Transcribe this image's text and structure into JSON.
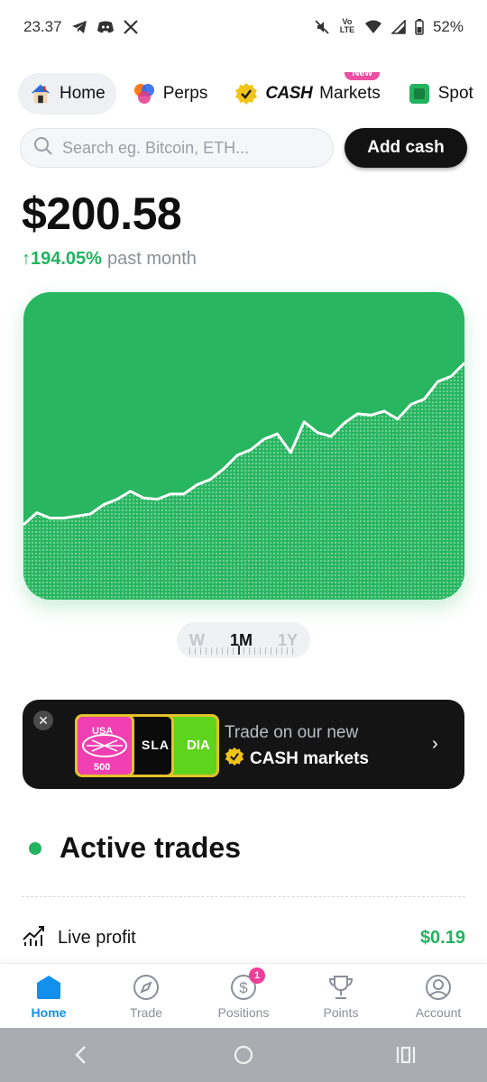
{
  "status_bar": {
    "time": "23.37",
    "battery": "52%",
    "icons": [
      "telegram-icon",
      "discord-icon",
      "x-icon",
      "mute-icon",
      "volte-icon",
      "wifi-icon",
      "signal-icon",
      "battery-icon"
    ],
    "volte_label": "Vo LTE"
  },
  "nav_tabs": {
    "items": [
      {
        "label": "Home",
        "icon": "home-house-icon",
        "active": true
      },
      {
        "label": "Perps",
        "icon": "perps-logo-icon"
      },
      {
        "label": "Markets",
        "prefix": "CASH",
        "icon": "verified-badge-icon",
        "badge": "New"
      },
      {
        "label": "Spot",
        "icon": "spot-square-icon"
      }
    ]
  },
  "search": {
    "placeholder": "Search eg. Bitcoin, ETH..."
  },
  "add_cash_label": "Add cash",
  "balance": "$200.58",
  "change": {
    "arrow": "↑",
    "percent": "194.05%",
    "label": "past month"
  },
  "chart_data": {
    "type": "area",
    "title": "",
    "xlabel": "",
    "ylabel": "",
    "y": [
      0.56,
      0.65,
      0.61,
      0.61,
      0.625,
      0.64,
      0.71,
      0.75,
      0.81,
      0.76,
      0.75,
      0.79,
      0.79,
      0.86,
      0.9,
      0.98,
      1.08,
      1.12,
      1.2,
      1.24,
      1.1,
      1.33,
      1.25,
      1.22,
      1.32,
      1.39,
      1.38,
      1.41,
      1.35,
      1.46,
      1.5,
      1.63,
      1.67,
      1.77
    ],
    "ylim": [
      0,
      2.3
    ],
    "grid": false,
    "color": "#28b660",
    "line_color": "#ffffff"
  },
  "timeframe": {
    "options": [
      {
        "label": "W",
        "active": false
      },
      {
        "label": "1M",
        "active": true
      },
      {
        "label": "1Y",
        "active": false
      }
    ]
  },
  "promo": {
    "close_icon": "close-icon",
    "art_usa": "USA",
    "art_500": "500",
    "art_sla": "SLA",
    "art_dia": "DIA",
    "line1": "Trade on our new",
    "line2": "CASH markets",
    "chevron": "›"
  },
  "active_trades": {
    "title": "Active trades",
    "live_profit_label": "Live profit",
    "live_profit_value": "$0.19"
  },
  "bottom_nav": {
    "items": [
      {
        "label": "Home",
        "icon": "home-icon",
        "active": true
      },
      {
        "label": "Trade",
        "icon": "trade-compass-icon"
      },
      {
        "label": "Positions",
        "icon": "positions-dollar-icon",
        "badge": "1"
      },
      {
        "label": "Points",
        "icon": "trophy-icon"
      },
      {
        "label": "Account",
        "icon": "account-icon"
      }
    ]
  },
  "system_nav": {
    "icons": [
      "back-icon",
      "home-circle-icon",
      "recents-icon"
    ]
  }
}
